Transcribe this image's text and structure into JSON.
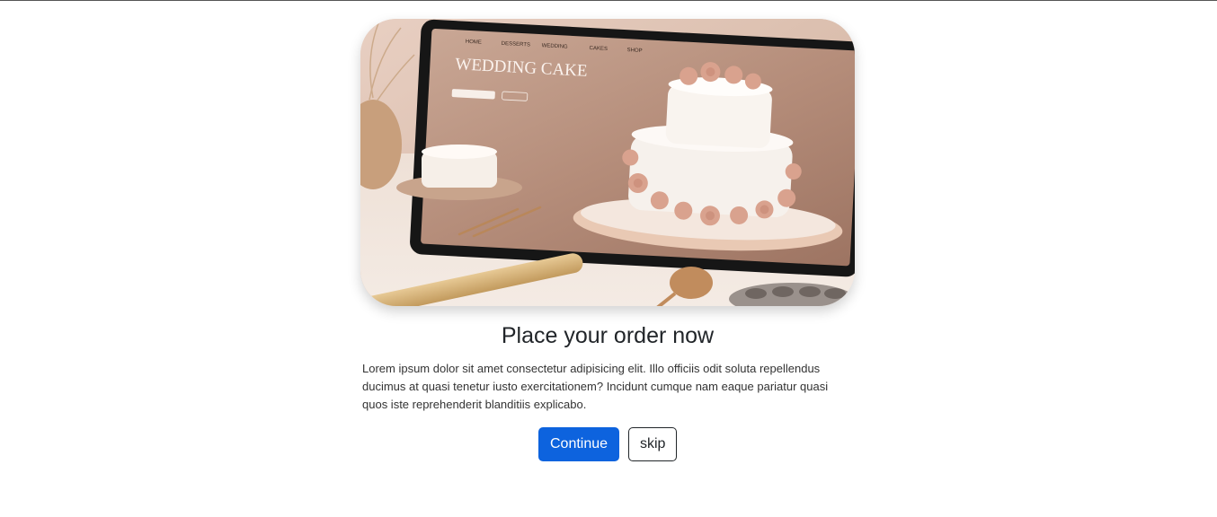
{
  "hero": {
    "alt": "Wedding cake website displayed on a tablet",
    "tablet_nav": [
      "HOME",
      "DESSERTS",
      "WEDDING",
      "CAKES",
      "SHOP"
    ],
    "tablet_title": "WEDDING CAKE"
  },
  "main": {
    "heading": "Place your order now",
    "body": "Lorem ipsum dolor sit amet consectetur adipisicing elit. Illo officiis odit soluta repellendus ducimus at quasi tenetur iusto exercitationem? Incidunt cumque nam eaque pariatur quasi quos iste reprehenderit blanditiis explicabo."
  },
  "actions": {
    "continue_label": "Continue",
    "skip_label": "skip"
  },
  "colors": {
    "primary": "#0d63de",
    "text": "#212529"
  }
}
